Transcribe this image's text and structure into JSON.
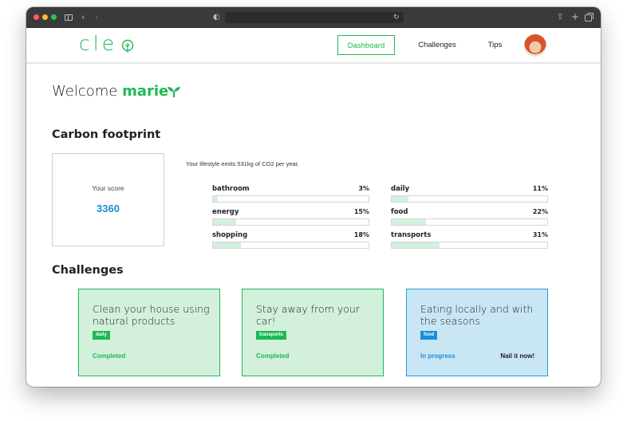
{
  "browser": {
    "icons": [
      "sidebar-icon",
      "back-icon",
      "forward-icon",
      "shield-icon",
      "reload-icon",
      "share-icon",
      "plus-icon",
      "tabs-icon"
    ]
  },
  "header": {
    "logo": "cle",
    "nav": [
      {
        "label": "Dashboard",
        "active": true
      },
      {
        "label": "Challenges",
        "active": false
      },
      {
        "label": "Tips",
        "active": false
      }
    ]
  },
  "welcome": {
    "prefix": "Welcome",
    "name": "marie"
  },
  "carbon": {
    "title": "Carbon footprint",
    "score_label": "Your score",
    "score_value": "3360",
    "emits_text": "Your lifestyle emits 531kg of CO2 per year.",
    "categories": [
      {
        "name": "bathroom",
        "pct_label": "3%",
        "pct": 3
      },
      {
        "name": "daily",
        "pct_label": "11%",
        "pct": 11
      },
      {
        "name": "energy",
        "pct_label": "15%",
        "pct": 15
      },
      {
        "name": "food",
        "pct_label": "22%",
        "pct": 22
      },
      {
        "name": "shopping",
        "pct_label": "18%",
        "pct": 18
      },
      {
        "name": "transports",
        "pct_label": "31%",
        "pct": 31
      }
    ]
  },
  "challenges": {
    "title": "Challenges",
    "cards": [
      {
        "title": "Clean your house using natural products",
        "tag": "daily",
        "status": "Completed",
        "action": ""
      },
      {
        "title": "Stay away from your car!",
        "tag": "transports",
        "status": "Completed",
        "action": ""
      },
      {
        "title": "Eating locally and with the seasons",
        "tag": "food",
        "status": "In progress",
        "action": "Nail it now!"
      }
    ]
  },
  "colors": {
    "brand_green": "#1db954",
    "accent_blue": "#1a8fd6",
    "card_green_bg": "#d2f0dc",
    "card_blue_bg": "#c9e6f5"
  }
}
